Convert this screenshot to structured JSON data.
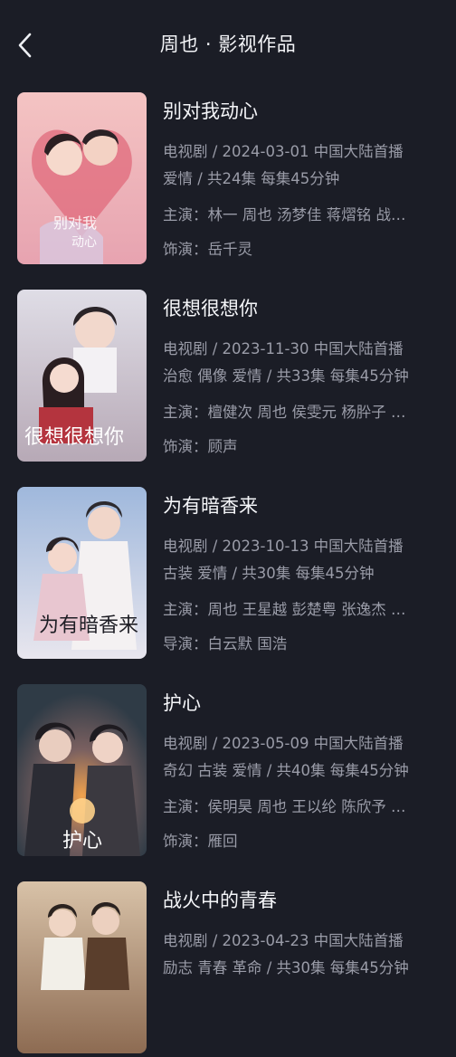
{
  "header": {
    "title": "周也 · 影视作品",
    "back_icon": "chevron-left-icon"
  },
  "works": [
    {
      "title": "别对我动心",
      "meta": "电视剧 / 2024-03-01 中国大陆首播",
      "tags": "爱情 / 共24集 每集45分钟",
      "cast": "主演：林一 周也 汤梦佳 蒋熠铭 战…",
      "role": "饰演：岳千灵",
      "poster_colors": [
        "#f2b6b8",
        "#c65b6a"
      ]
    },
    {
      "title": "很想很想你",
      "meta": "电视剧 / 2023-11-30 中国大陆首播",
      "tags": "治愈 偶像 爱情 / 共33集 每集45分钟",
      "cast": "主演：檀健次 周也 侯雯元 杨肸子 …",
      "role": "饰演：顾声",
      "poster_colors": [
        "#e7e6ec",
        "#8f5a5e"
      ]
    },
    {
      "title": "为有暗香来",
      "meta": "电视剧 / 2023-10-13 中国大陆首播",
      "tags": "古装 爱情 / 共30集 每集45分钟",
      "cast": "主演：周也 王星越 彭楚粤 张逸杰 …",
      "role": "导演：白云默 国浩",
      "poster_colors": [
        "#bcd1ea",
        "#f2f0f3"
      ]
    },
    {
      "title": "护心",
      "meta": "电视剧 / 2023-05-09 中国大陆首播",
      "tags": "奇幻 古装 爱情 / 共40集 每集45分钟",
      "cast": "主演：侯明昊 周也 王以纶 陈欣予 …",
      "role": "饰演：雁回",
      "poster_colors": [
        "#4a5a68",
        "#d9873e"
      ]
    },
    {
      "title": "战火中的青春",
      "meta": "电视剧 / 2023-04-23 中国大陆首播",
      "tags": "励志 青春 革命 / 共30集 每集45分钟",
      "cast": "",
      "role": "",
      "poster_colors": [
        "#c8a88a",
        "#6b4a35"
      ]
    }
  ]
}
